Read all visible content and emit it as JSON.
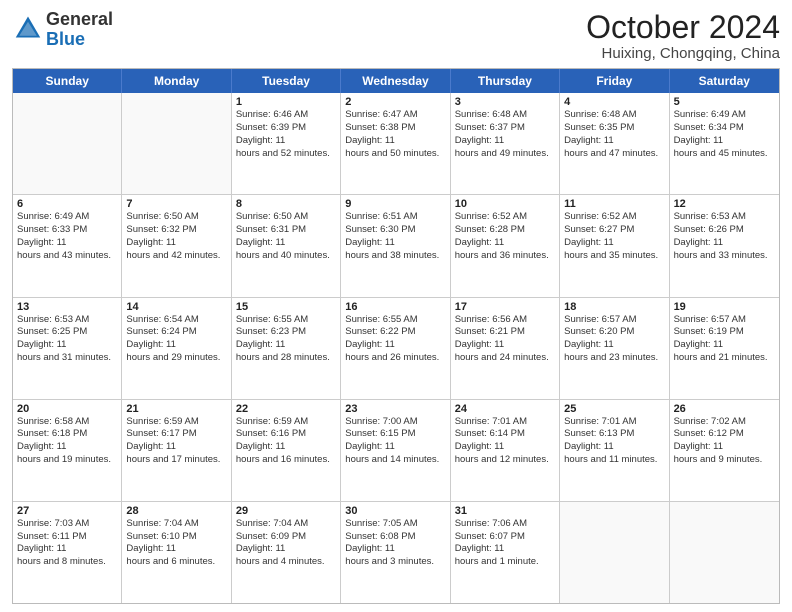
{
  "header": {
    "logo_general": "General",
    "logo_blue": "Blue",
    "month": "October 2024",
    "location": "Huixing, Chongqing, China"
  },
  "days_of_week": [
    "Sunday",
    "Monday",
    "Tuesday",
    "Wednesday",
    "Thursday",
    "Friday",
    "Saturday"
  ],
  "weeks": [
    [
      {
        "day": "",
        "sunrise": "",
        "sunset": "",
        "daylight": ""
      },
      {
        "day": "",
        "sunrise": "",
        "sunset": "",
        "daylight": ""
      },
      {
        "day": "1",
        "sunrise": "Sunrise: 6:46 AM",
        "sunset": "Sunset: 6:39 PM",
        "daylight": "Daylight: 11 hours and 52 minutes."
      },
      {
        "day": "2",
        "sunrise": "Sunrise: 6:47 AM",
        "sunset": "Sunset: 6:38 PM",
        "daylight": "Daylight: 11 hours and 50 minutes."
      },
      {
        "day": "3",
        "sunrise": "Sunrise: 6:48 AM",
        "sunset": "Sunset: 6:37 PM",
        "daylight": "Daylight: 11 hours and 49 minutes."
      },
      {
        "day": "4",
        "sunrise": "Sunrise: 6:48 AM",
        "sunset": "Sunset: 6:35 PM",
        "daylight": "Daylight: 11 hours and 47 minutes."
      },
      {
        "day": "5",
        "sunrise": "Sunrise: 6:49 AM",
        "sunset": "Sunset: 6:34 PM",
        "daylight": "Daylight: 11 hours and 45 minutes."
      }
    ],
    [
      {
        "day": "6",
        "sunrise": "Sunrise: 6:49 AM",
        "sunset": "Sunset: 6:33 PM",
        "daylight": "Daylight: 11 hours and 43 minutes."
      },
      {
        "day": "7",
        "sunrise": "Sunrise: 6:50 AM",
        "sunset": "Sunset: 6:32 PM",
        "daylight": "Daylight: 11 hours and 42 minutes."
      },
      {
        "day": "8",
        "sunrise": "Sunrise: 6:50 AM",
        "sunset": "Sunset: 6:31 PM",
        "daylight": "Daylight: 11 hours and 40 minutes."
      },
      {
        "day": "9",
        "sunrise": "Sunrise: 6:51 AM",
        "sunset": "Sunset: 6:30 PM",
        "daylight": "Daylight: 11 hours and 38 minutes."
      },
      {
        "day": "10",
        "sunrise": "Sunrise: 6:52 AM",
        "sunset": "Sunset: 6:28 PM",
        "daylight": "Daylight: 11 hours and 36 minutes."
      },
      {
        "day": "11",
        "sunrise": "Sunrise: 6:52 AM",
        "sunset": "Sunset: 6:27 PM",
        "daylight": "Daylight: 11 hours and 35 minutes."
      },
      {
        "day": "12",
        "sunrise": "Sunrise: 6:53 AM",
        "sunset": "Sunset: 6:26 PM",
        "daylight": "Daylight: 11 hours and 33 minutes."
      }
    ],
    [
      {
        "day": "13",
        "sunrise": "Sunrise: 6:53 AM",
        "sunset": "Sunset: 6:25 PM",
        "daylight": "Daylight: 11 hours and 31 minutes."
      },
      {
        "day": "14",
        "sunrise": "Sunrise: 6:54 AM",
        "sunset": "Sunset: 6:24 PM",
        "daylight": "Daylight: 11 hours and 29 minutes."
      },
      {
        "day": "15",
        "sunrise": "Sunrise: 6:55 AM",
        "sunset": "Sunset: 6:23 PM",
        "daylight": "Daylight: 11 hours and 28 minutes."
      },
      {
        "day": "16",
        "sunrise": "Sunrise: 6:55 AM",
        "sunset": "Sunset: 6:22 PM",
        "daylight": "Daylight: 11 hours and 26 minutes."
      },
      {
        "day": "17",
        "sunrise": "Sunrise: 6:56 AM",
        "sunset": "Sunset: 6:21 PM",
        "daylight": "Daylight: 11 hours and 24 minutes."
      },
      {
        "day": "18",
        "sunrise": "Sunrise: 6:57 AM",
        "sunset": "Sunset: 6:20 PM",
        "daylight": "Daylight: 11 hours and 23 minutes."
      },
      {
        "day": "19",
        "sunrise": "Sunrise: 6:57 AM",
        "sunset": "Sunset: 6:19 PM",
        "daylight": "Daylight: 11 hours and 21 minutes."
      }
    ],
    [
      {
        "day": "20",
        "sunrise": "Sunrise: 6:58 AM",
        "sunset": "Sunset: 6:18 PM",
        "daylight": "Daylight: 11 hours and 19 minutes."
      },
      {
        "day": "21",
        "sunrise": "Sunrise: 6:59 AM",
        "sunset": "Sunset: 6:17 PM",
        "daylight": "Daylight: 11 hours and 17 minutes."
      },
      {
        "day": "22",
        "sunrise": "Sunrise: 6:59 AM",
        "sunset": "Sunset: 6:16 PM",
        "daylight": "Daylight: 11 hours and 16 minutes."
      },
      {
        "day": "23",
        "sunrise": "Sunrise: 7:00 AM",
        "sunset": "Sunset: 6:15 PM",
        "daylight": "Daylight: 11 hours and 14 minutes."
      },
      {
        "day": "24",
        "sunrise": "Sunrise: 7:01 AM",
        "sunset": "Sunset: 6:14 PM",
        "daylight": "Daylight: 11 hours and 12 minutes."
      },
      {
        "day": "25",
        "sunrise": "Sunrise: 7:01 AM",
        "sunset": "Sunset: 6:13 PM",
        "daylight": "Daylight: 11 hours and 11 minutes."
      },
      {
        "day": "26",
        "sunrise": "Sunrise: 7:02 AM",
        "sunset": "Sunset: 6:12 PM",
        "daylight": "Daylight: 11 hours and 9 minutes."
      }
    ],
    [
      {
        "day": "27",
        "sunrise": "Sunrise: 7:03 AM",
        "sunset": "Sunset: 6:11 PM",
        "daylight": "Daylight: 11 hours and 8 minutes."
      },
      {
        "day": "28",
        "sunrise": "Sunrise: 7:04 AM",
        "sunset": "Sunset: 6:10 PM",
        "daylight": "Daylight: 11 hours and 6 minutes."
      },
      {
        "day": "29",
        "sunrise": "Sunrise: 7:04 AM",
        "sunset": "Sunset: 6:09 PM",
        "daylight": "Daylight: 11 hours and 4 minutes."
      },
      {
        "day": "30",
        "sunrise": "Sunrise: 7:05 AM",
        "sunset": "Sunset: 6:08 PM",
        "daylight": "Daylight: 11 hours and 3 minutes."
      },
      {
        "day": "31",
        "sunrise": "Sunrise: 7:06 AM",
        "sunset": "Sunset: 6:07 PM",
        "daylight": "Daylight: 11 hours and 1 minute."
      },
      {
        "day": "",
        "sunrise": "",
        "sunset": "",
        "daylight": ""
      },
      {
        "day": "",
        "sunrise": "",
        "sunset": "",
        "daylight": ""
      }
    ]
  ]
}
